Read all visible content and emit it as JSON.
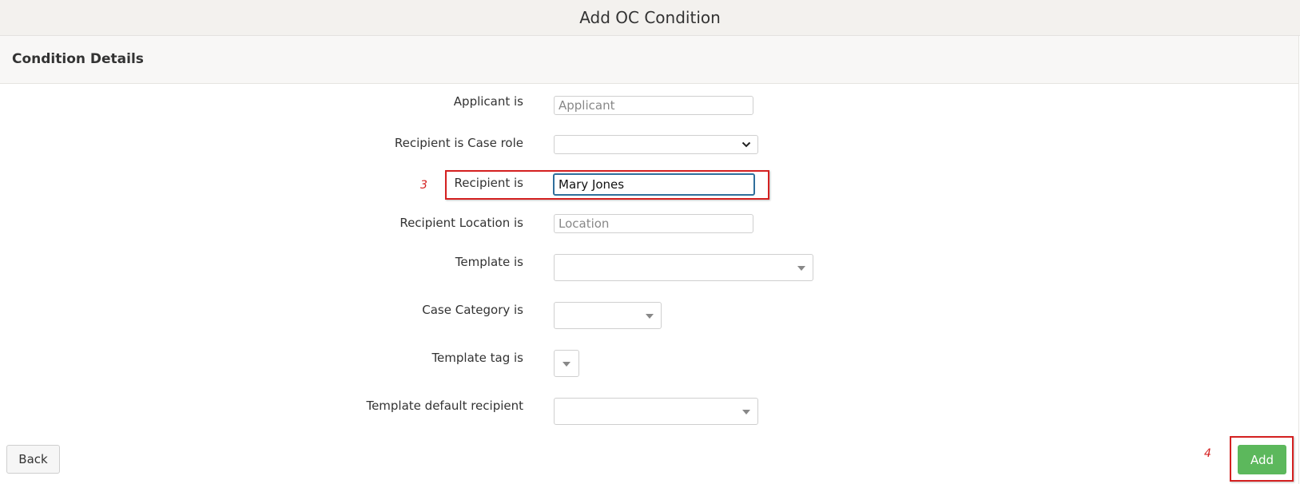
{
  "header": {
    "title": "Add OC Condition"
  },
  "section": {
    "title": "Condition Details"
  },
  "form": {
    "applicant": {
      "label": "Applicant is",
      "placeholder": "Applicant",
      "value": ""
    },
    "recipient_case_role": {
      "label": "Recipient is Case role",
      "value": ""
    },
    "recipient": {
      "label": "Recipient is",
      "value": "Mary Jones"
    },
    "recipient_location": {
      "label": "Recipient Location is",
      "placeholder": "Location",
      "value": ""
    },
    "template": {
      "label": "Template is",
      "value": ""
    },
    "case_category": {
      "label": "Case Category is",
      "value": ""
    },
    "template_tag": {
      "label": "Template tag is",
      "value": ""
    },
    "template_default_recipient": {
      "label": "Template default recipient",
      "value": ""
    }
  },
  "annotations": {
    "step3": "3",
    "step4": "4"
  },
  "buttons": {
    "back": "Back",
    "add": "Add"
  },
  "colors": {
    "add_button": "#5cb85c",
    "annotation": "#d42020",
    "focus_border": "#2f6f9c"
  }
}
